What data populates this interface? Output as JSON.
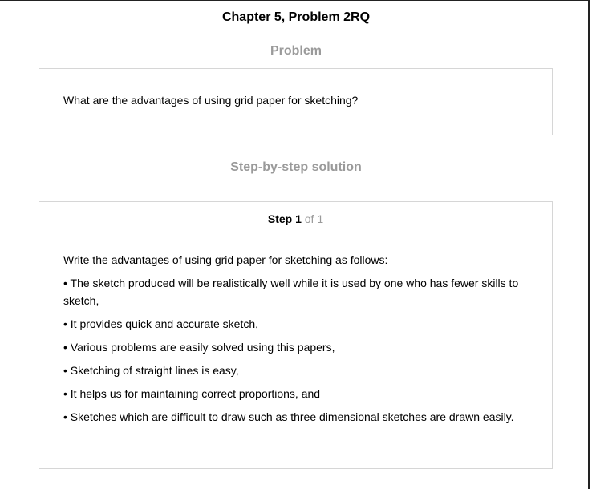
{
  "chapter_title": "Chapter 5, Problem 2RQ",
  "problem": {
    "heading": "Problem",
    "text": "What are the advantages of using grid paper for sketching?"
  },
  "solution": {
    "heading": "Step-by-step solution",
    "step_label": "Step 1",
    "step_total": " of 1",
    "intro": "Write the advantages of using grid paper for sketching as follows:",
    "points": [
      "• The sketch produced will be realistically well while it is used by one who has fewer skills to sketch,",
      "• It provides quick and accurate sketch,",
      "• Various problems are easily solved using this papers,",
      "• Sketching of straight lines is easy,",
      "• It helps us for maintaining correct proportions, and",
      "• Sketches which are difficult to draw such as three dimensional sketches are drawn easily."
    ]
  }
}
